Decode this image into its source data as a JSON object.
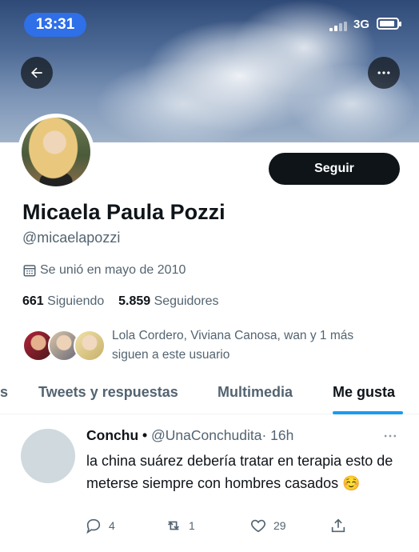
{
  "status_bar": {
    "time": "13:31",
    "network": "3G"
  },
  "profile": {
    "follow_button": "Seguir",
    "name": "Micaela Paula Pozzi",
    "handle": "@micaelapozzi",
    "joined": "Se unió en mayo de 2010",
    "following_count": "661",
    "following_label": "Siguiendo",
    "followers_count": "5.859",
    "followers_label": "Seguidores",
    "mutuals_line1": "Lola Cordero, Viviana Canosa, wan y 1 más",
    "mutuals_line2": "siguen a este usuario"
  },
  "tabs": [
    {
      "label": "s"
    },
    {
      "label": "Tweets y respuestas"
    },
    {
      "label": "Multimedia"
    },
    {
      "label": "Me gusta",
      "active": true
    }
  ],
  "tweet": {
    "author": "Conchu",
    "bullet": "•",
    "handle": "@UnaConchudita",
    "time": "· 16h",
    "text": "la china suárez debería tratar en terapia esto de meterse siempre con hombres casados ☺️",
    "replies": "4",
    "retweets": "1",
    "likes": "29"
  },
  "icons": [
    "back-arrow-icon",
    "more-icon",
    "calendar-icon",
    "reply-icon",
    "retweet-icon",
    "like-icon",
    "share-icon"
  ],
  "colors": {
    "accent": "#1d9bf0",
    "time_pill": "#2f6fe8",
    "follow_button": "#0f1419"
  }
}
